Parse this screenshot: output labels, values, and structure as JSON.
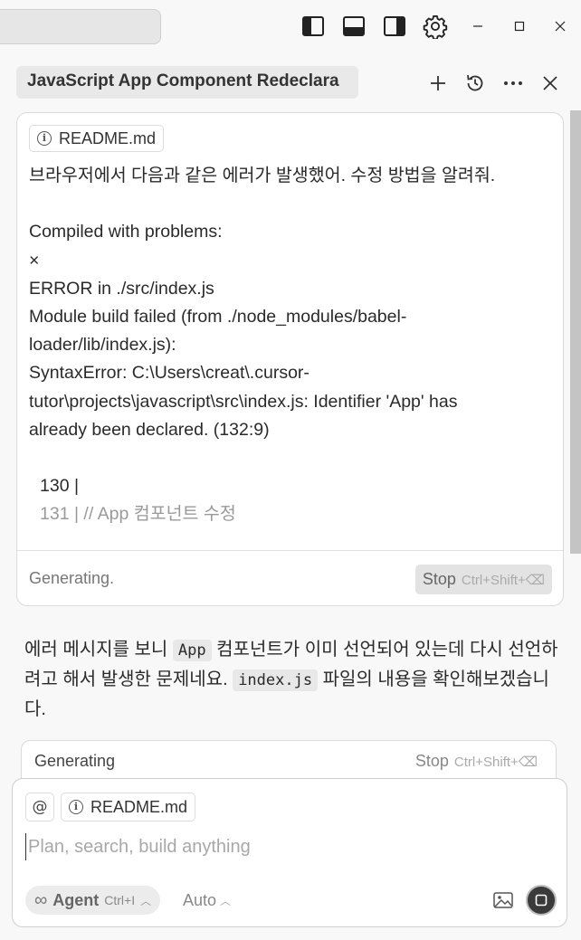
{
  "titlebar": {
    "icons": [
      "toggle-left-panel-icon",
      "toggle-bottom-panel-icon",
      "toggle-right-panel-icon",
      "gear-icon"
    ],
    "window_controls": {
      "minimize": "–",
      "maximize": "□",
      "close": "✕"
    }
  },
  "chat_header": {
    "title": "JavaScript App Component Redeclara",
    "actions": [
      "plus-icon",
      "history-icon",
      "more-icon",
      "close-icon"
    ]
  },
  "user_message": {
    "attachment": "README.md",
    "lines": [
      "브라우저에서 다음과 같은 에러가 발생했어. 수정 방법을 알려줘.",
      "",
      "Compiled with problems:",
      "×",
      "ERROR in ./src/index.js",
      "Module build failed (from ./node_modules/babel-",
      "loader/lib/index.js):",
      "SyntaxError: C:\\Users\\creat\\.cursor-",
      "tutor\\projects\\javascript\\src\\index.js: Identifier 'App' has",
      "already been declared. (132:9)",
      "",
      "130 |",
      "131 | // App 컴포넌트 수정"
    ],
    "status": "Generating.",
    "stop_label": "Stop",
    "stop_shortcut": "Ctrl+Shift+⌫"
  },
  "assistant_message": {
    "part1": "에러 메시지를 보니 ",
    "code1": "App",
    "part2": " 컴포넌트가 이미 선언되어 있는데 다시 선언하려고 해서 발생한 문제네요. ",
    "code2": "index.js",
    "part3": " 파일의 내용을 확인해보겠습니다."
  },
  "generating_card": {
    "label": "Generating",
    "stop_label": "Stop",
    "stop_shortcut": "Ctrl+Shift+⌫"
  },
  "composer": {
    "at_symbol": "@",
    "attachment": "README.md",
    "placeholder": "Plan, search, build anything",
    "agent_label": "Agent",
    "agent_shortcut": "Ctrl+I",
    "model_label": "Auto"
  }
}
